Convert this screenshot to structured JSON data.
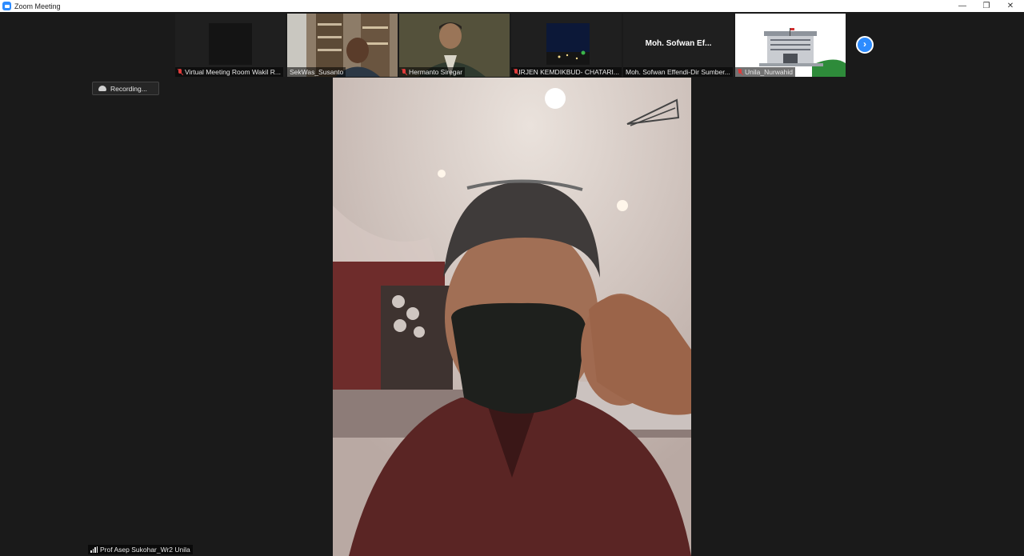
{
  "window": {
    "title": "Zoom Meeting"
  },
  "window_controls": {
    "minimize": "—",
    "restore": "❐",
    "close": "✕"
  },
  "participants": [
    {
      "name": "Virtual Meeting Room Wakil R...",
      "muted": true
    },
    {
      "name": "SekWas_Susanto",
      "muted": false
    },
    {
      "name": "Hermanto Siregar",
      "muted": true
    },
    {
      "name": "IRJEN KEMDIKBUD- CHATARI...",
      "muted": true
    },
    {
      "name": "Moh. Sofwan Effendi-Dir Sumber...",
      "muted": false,
      "display_name": "Moh. Sofwan Ef..."
    },
    {
      "name": "Unila_Nurwahid",
      "muted": true
    }
  ],
  "next_page_icon": "›",
  "recording": {
    "label": "Recording..."
  },
  "active_speaker": {
    "name": "Prof Asep Sukohar_Wr2 Unila"
  },
  "colors": {
    "accent": "#2d8cff",
    "muted_red": "#e03b3b",
    "background": "#1a1a1a"
  }
}
